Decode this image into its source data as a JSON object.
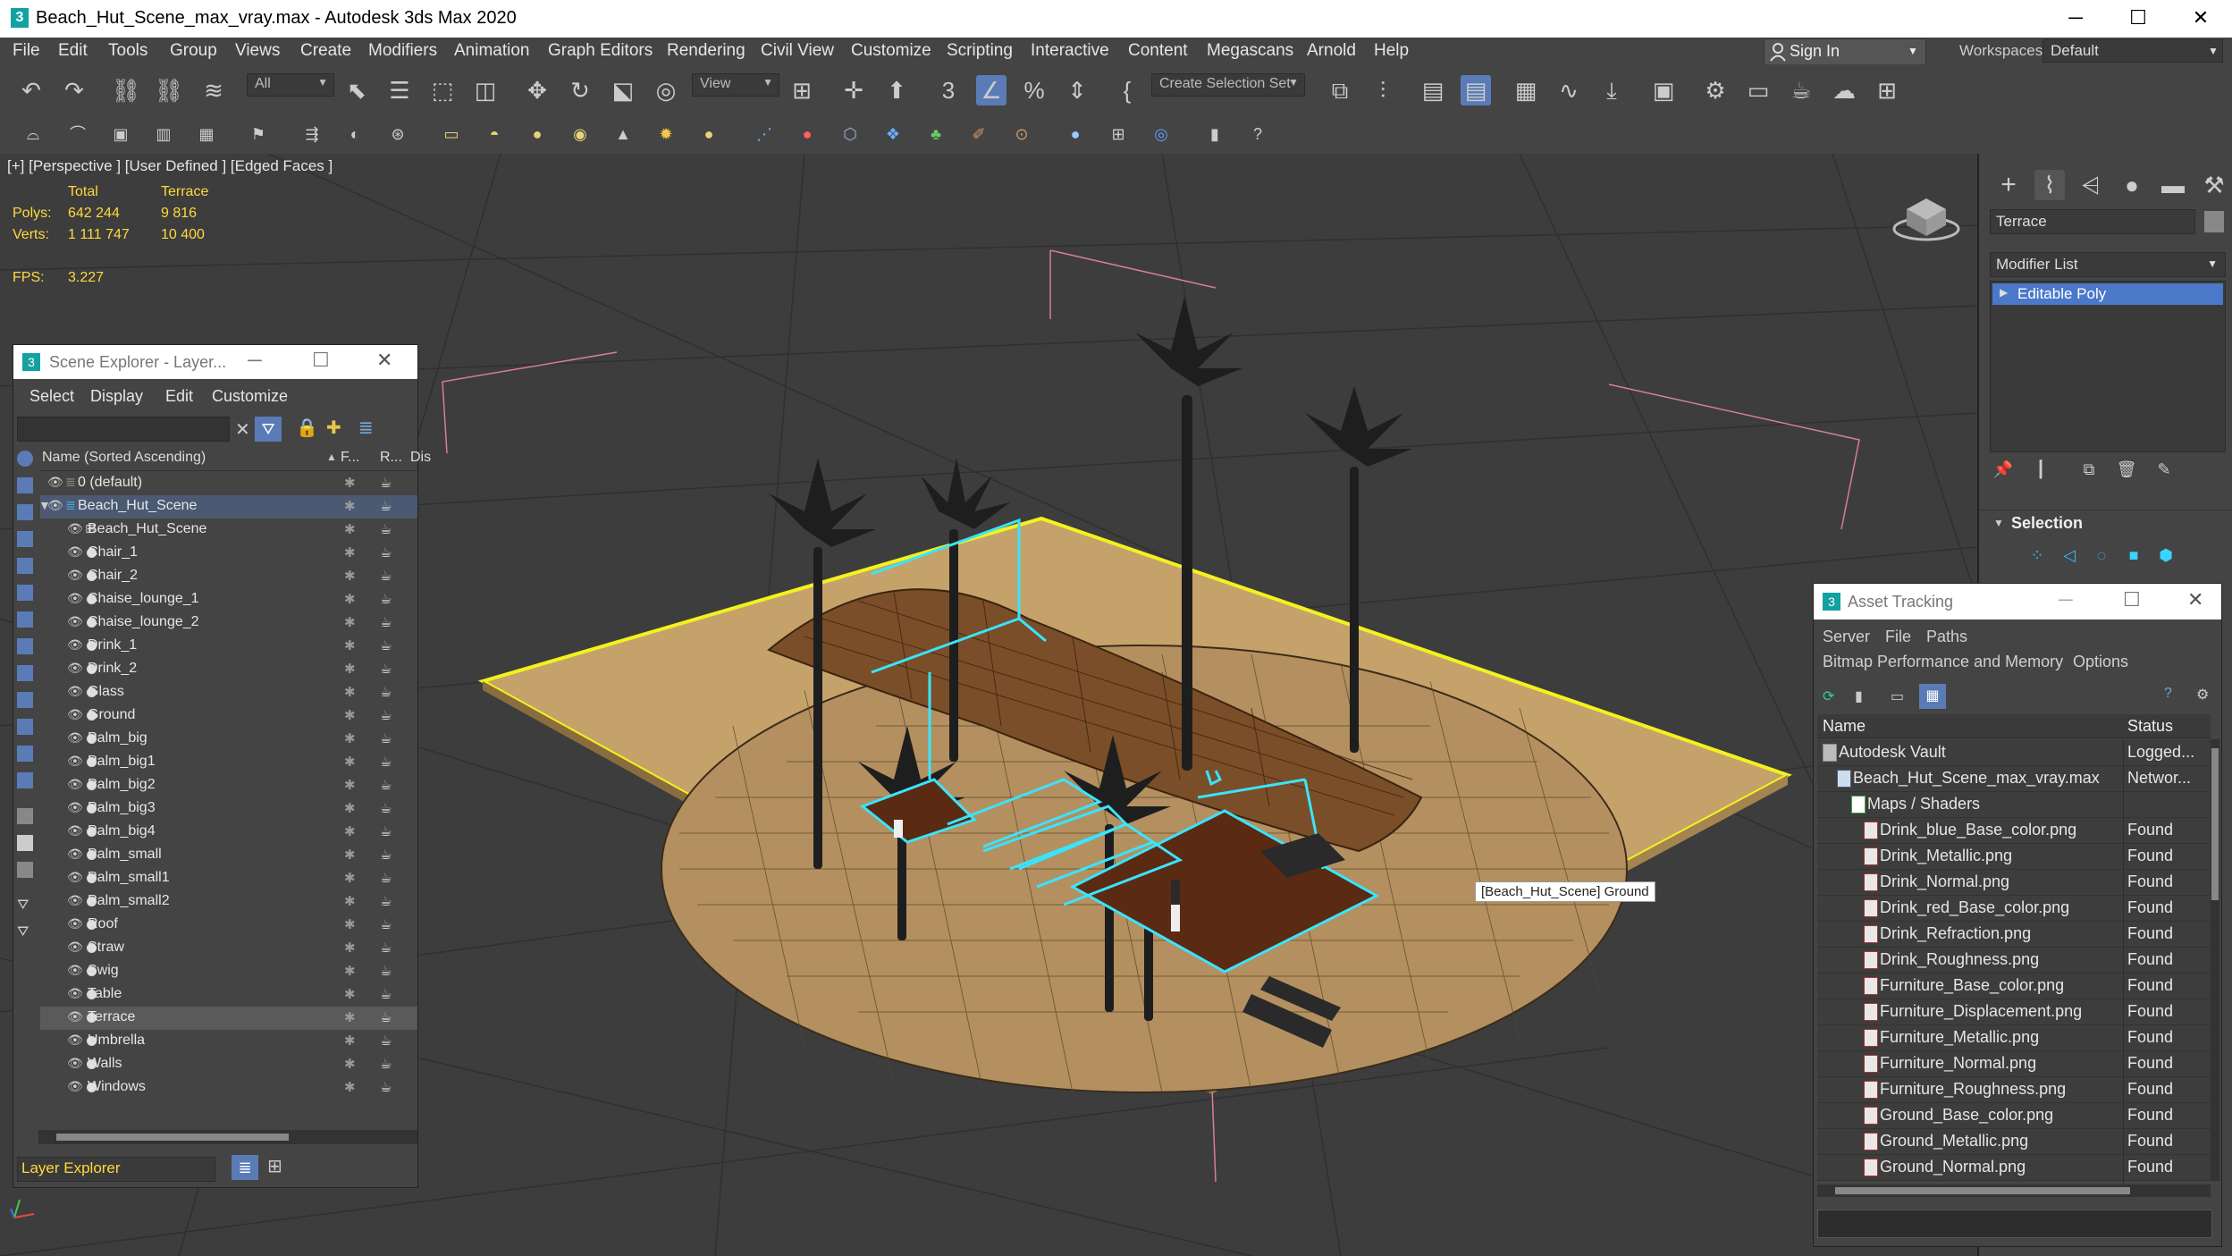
{
  "window": {
    "title": "Beach_Hut_Scene_max_vray.max - Autodesk 3ds Max 2020",
    "app_icon": "3",
    "minimize": "─",
    "maximize": "☐",
    "close": "✕"
  },
  "menu": [
    "File",
    "Edit",
    "Tools",
    "Group",
    "Views",
    "Create",
    "Modifiers",
    "Animation",
    "Graph Editors",
    "Rendering",
    "Civil View",
    "Customize",
    "Scripting",
    "Interactive",
    "Content",
    "Megascans",
    "Arnold",
    "Help"
  ],
  "signin": "Sign In",
  "workspaces_label": "Workspaces:",
  "workspace_value": "Default",
  "toolbar": {
    "selection_filter": "All",
    "ref_coord": "View",
    "selection_set": "Create Selection Set"
  },
  "viewport": {
    "label": "[+] [Perspective ] [User Defined ] [Edged Faces ]",
    "stats": {
      "col_total": "Total",
      "col_sel": "Terrace",
      "polys_label": "Polys:",
      "polys_total": "642 244",
      "polys_sel": "9 816",
      "verts_label": "Verts:",
      "verts_total": "1 111 747",
      "verts_sel": "10 400",
      "fps_label": "FPS:",
      "fps_value": "3.227"
    },
    "tooltip": "[Beach_Hut_Scene] Ground"
  },
  "command_panel": {
    "object_name": "Terrace",
    "modifier_list": "Modifier List",
    "stack_item": "Editable Poly",
    "rollout": "Selection"
  },
  "scene_explorer": {
    "title": "Scene Explorer - Layer...",
    "menus": [
      "Select",
      "Display",
      "Edit",
      "Customize"
    ],
    "col_name": "Name (Sorted Ascending)",
    "col_f": "F...",
    "col_r": "R...",
    "col_dis": "Dis",
    "rows": [
      {
        "label": "0 (default)",
        "level": 0
      },
      {
        "label": "Beach_Hut_Scene",
        "level": 0
      },
      {
        "label": "Beach_Hut_Scene",
        "level": 1
      },
      {
        "label": "Chair_1",
        "level": 1
      },
      {
        "label": "Chair_2",
        "level": 1
      },
      {
        "label": "Chaise_lounge_1",
        "level": 1
      },
      {
        "label": "Chaise_lounge_2",
        "level": 1
      },
      {
        "label": "Drink_1",
        "level": 1
      },
      {
        "label": "Drink_2",
        "level": 1
      },
      {
        "label": "Glass",
        "level": 1
      },
      {
        "label": "Ground",
        "level": 1
      },
      {
        "label": "Palm_big",
        "level": 1
      },
      {
        "label": "Palm_big1",
        "level": 1
      },
      {
        "label": "Palm_big2",
        "level": 1
      },
      {
        "label": "Palm_big3",
        "level": 1
      },
      {
        "label": "Palm_big4",
        "level": 1
      },
      {
        "label": "Palm_small",
        "level": 1
      },
      {
        "label": "Palm_small1",
        "level": 1
      },
      {
        "label": "Palm_small2",
        "level": 1
      },
      {
        "label": "Roof",
        "level": 1
      },
      {
        "label": "Straw",
        "level": 1
      },
      {
        "label": "Swig",
        "level": 1
      },
      {
        "label": "Table",
        "level": 1
      },
      {
        "label": "Terrace",
        "level": 1
      },
      {
        "label": "Umbrella",
        "level": 1
      },
      {
        "label": "Walls",
        "level": 1
      },
      {
        "label": "Windows",
        "level": 1
      }
    ],
    "footer_label": "Layer Explorer"
  },
  "asset_tracking": {
    "title": "Asset Tracking",
    "menu1": [
      "Server",
      "File",
      "Paths"
    ],
    "menu2": [
      "Bitmap Performance and Memory",
      "Options"
    ],
    "col_name": "Name",
    "col_status": "Status",
    "rows": [
      {
        "name": "Autodesk Vault",
        "status": "Logged...",
        "level": 0
      },
      {
        "name": "Beach_Hut_Scene_max_vray.max",
        "status": "Networ...",
        "level": 1
      },
      {
        "name": "Maps / Shaders",
        "status": "",
        "level": 2
      },
      {
        "name": "Drink_blue_Base_color.png",
        "status": "Found",
        "level": 3
      },
      {
        "name": "Drink_Metallic.png",
        "status": "Found",
        "level": 3
      },
      {
        "name": "Drink_Normal.png",
        "status": "Found",
        "level": 3
      },
      {
        "name": "Drink_red_Base_color.png",
        "status": "Found",
        "level": 3
      },
      {
        "name": "Drink_Refraction.png",
        "status": "Found",
        "level": 3
      },
      {
        "name": "Drink_Roughness.png",
        "status": "Found",
        "level": 3
      },
      {
        "name": "Furniture_Base_color.png",
        "status": "Found",
        "level": 3
      },
      {
        "name": "Furniture_Displacement.png",
        "status": "Found",
        "level": 3
      },
      {
        "name": "Furniture_Metallic.png",
        "status": "Found",
        "level": 3
      },
      {
        "name": "Furniture_Normal.png",
        "status": "Found",
        "level": 3
      },
      {
        "name": "Furniture_Roughness.png",
        "status": "Found",
        "level": 3
      },
      {
        "name": "Ground_Base_color.png",
        "status": "Found",
        "level": 3
      },
      {
        "name": "Ground_Metallic.png",
        "status": "Found",
        "level": 3
      },
      {
        "name": "Ground_Normal.png",
        "status": "Found",
        "level": 3
      }
    ]
  },
  "colors": {
    "accent_selection": "#4b78c8",
    "viewport_bg": "#3d3d3d",
    "wire_cyan": "#39e4ff",
    "wire_yellow": "#f2f21e",
    "sand": "#c6a26b",
    "stats_yellow": "#ffd93c"
  }
}
